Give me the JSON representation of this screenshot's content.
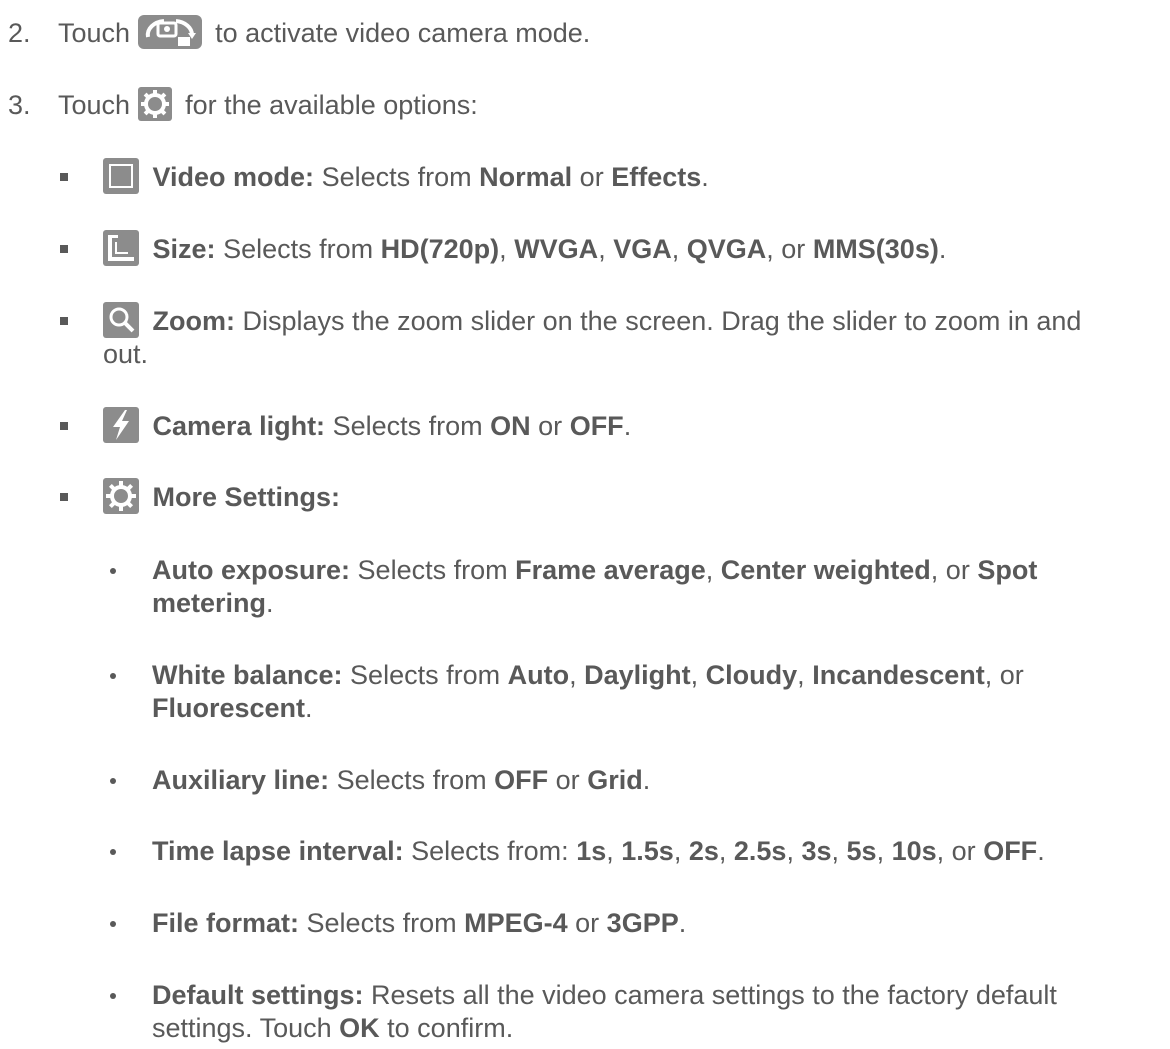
{
  "steps": [
    {
      "number": "2.",
      "pre": "Touch",
      "post": "to activate video camera mode.",
      "icon": "camera-switch-icon"
    },
    {
      "number": "3.",
      "pre": "Touch",
      "post": "for the available options:",
      "icon": "gear-icon"
    }
  ],
  "options": {
    "video_mode": {
      "icon": "square-frame-icon",
      "label": "Video mode:",
      "t1": "Selects from",
      "v1": "Normal",
      "t2": "or",
      "v2": "Effects",
      "t3": "."
    },
    "size": {
      "icon": "size-corner-icon",
      "label": "Size:",
      "t1": "Selects from",
      "v1": "HD(720p)",
      "c1": ",",
      "v2": "WVGA",
      "c2": ",",
      "v3": "VGA",
      "c3": ",",
      "v4": "QVGA",
      "c4": ", or",
      "v5": "MMS(30s)",
      "end": "."
    },
    "zoom": {
      "icon": "magnifier-icon",
      "label": "Zoom:",
      "text_line1": "Displays the zoom slider on the screen. Drag the slider to zoom in and",
      "text_line2": "out."
    },
    "camera_light": {
      "icon": "flash-icon",
      "label": "Camera light:",
      "t1": "Selects from",
      "v1": "ON",
      "t2": "or",
      "v2": "OFF",
      "t3": "."
    },
    "more_settings": {
      "icon": "gear-icon",
      "label": "More Settings:"
    }
  },
  "more": {
    "auto_exposure": {
      "label": "Auto exposure:",
      "t1": "Selects from",
      "v1": "Frame average",
      "c1": ",",
      "v2": "Center weighted",
      "c2": ", or",
      "v3a": "Spot",
      "v3b": "metering",
      "end": "."
    },
    "white_balance": {
      "label": "White balance:",
      "t1": "Selects from",
      "v1": "Auto",
      "c1": ",",
      "v2": "Daylight",
      "c2": ",",
      "v3": "Cloudy",
      "c3": ",",
      "v4": "Incandescent",
      "c4": ", or",
      "v5": "Fluorescent",
      "end": "."
    },
    "auxiliary_line": {
      "label": "Auxiliary line:",
      "t1": "Selects from",
      "v1": "OFF",
      "t2": "or",
      "v2": "Grid",
      "end": "."
    },
    "time_lapse": {
      "label": "Time lapse interval:",
      "t1": "Selects from:",
      "v1": "1s",
      "v2": "1.5s",
      "v3": "2s",
      "v4": "2.5s",
      "v5": "3s",
      "v6": "5s",
      "v7": "10s",
      "or": ", or",
      "v8": "OFF",
      "end": "."
    },
    "file_format": {
      "label": "File format:",
      "t1": "Selects from",
      "v1": "MPEG-4",
      "t2": "or",
      "v2": "3GPP",
      "end": "."
    },
    "default_settings": {
      "label": "Default settings:",
      "line1": "Resets all the video camera settings to the factory default",
      "line2a": "settings. Touch",
      "ok": "OK",
      "line2b": "to confirm."
    }
  },
  "colors": {
    "text": "#595959",
    "icon_bg": "#8c8c8c",
    "icon_fg": "#ffffff"
  }
}
